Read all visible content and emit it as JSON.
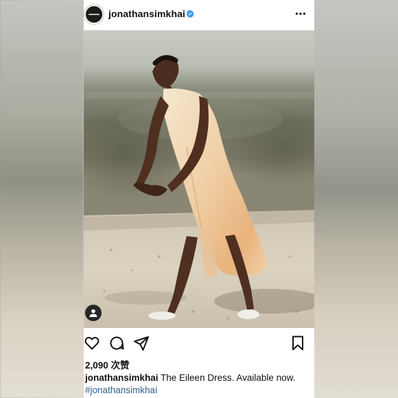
{
  "post": {
    "username": "jonathansimkhai",
    "verified": true,
    "likes": "2,090 次赞",
    "caption_user": "jonathansimkhai",
    "caption_text": " The Eileen Dress. Available now.",
    "hashtag": "#jonathansimkhai"
  },
  "icons": {
    "avatar": "brand-logo-avatar",
    "verified": "verified-badge-icon",
    "more": "more-options-icon",
    "tagged_user": "tagged-user-icon",
    "like": "heart-icon",
    "comment": "comment-icon",
    "share": "send-icon",
    "save": "bookmark-icon"
  },
  "colors": {
    "verified_blue": "#3897f0",
    "hashtag_link": "#2b5f8f",
    "text": "#111111"
  }
}
